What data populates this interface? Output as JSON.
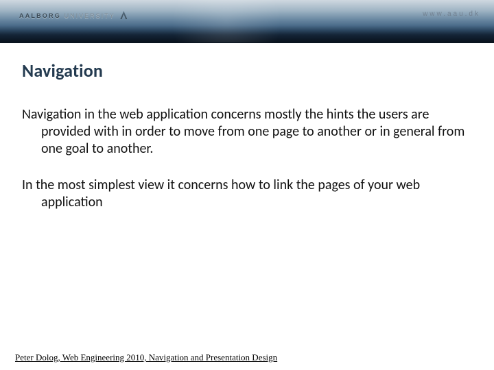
{
  "banner": {
    "org_bold": "AALBORG",
    "org_light": "UNIVERSITY",
    "url": "www.aau.dk"
  },
  "slide": {
    "title": "Navigation",
    "para1": "Navigation in the web application concerns mostly the hints the users are provided with in order to move from one page to another or in general from one goal to another.",
    "para2": "In the most simplest view it concerns how to link the pages of your web application"
  },
  "footer": "Peter Dolog, Web Engineering 2010, Navigation and Presentation Design"
}
